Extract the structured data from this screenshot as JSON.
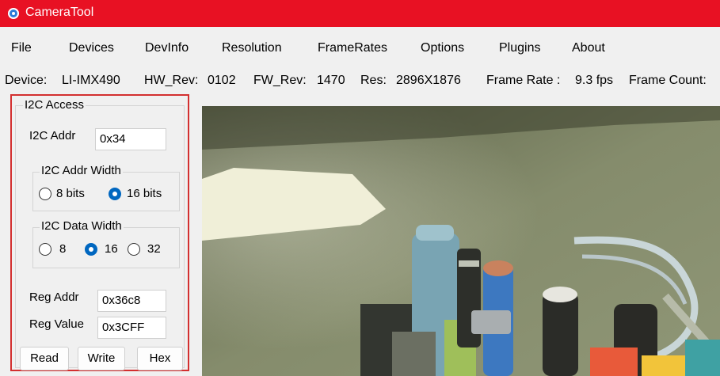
{
  "window": {
    "title": "CameraTool"
  },
  "menu": [
    "File",
    "Devices",
    "DevInfo",
    "Resolution",
    "FrameRates",
    "Options",
    "Plugins",
    "About"
  ],
  "info": {
    "device_label": "Device:",
    "device": "LI-IMX490",
    "hw_label": "HW_Rev:",
    "hw": "0102",
    "fw_label": "FW_Rev:",
    "fw": "1470",
    "res_label": "Res:",
    "res": "2896X1876",
    "fps_label": "Frame Rate :",
    "fps": "9.3 fps",
    "count_label": "Frame Count:"
  },
  "i2c": {
    "title": "I2C Access",
    "addr_label": "I2C Addr",
    "addr_value": "0x34",
    "addr_width": {
      "title": "I2C Addr Width",
      "options": [
        "8 bits",
        "16 bits"
      ],
      "selected": "16 bits"
    },
    "data_width": {
      "title": "I2C Data Width",
      "options": [
        "8",
        "16",
        "32"
      ],
      "selected": "16"
    },
    "reg_addr_label": "Reg Addr",
    "reg_addr_value": "0x36c8",
    "reg_value_label": "Reg Value",
    "reg_value_value": "0x3CFF",
    "buttons": {
      "read": "Read",
      "write": "Write",
      "hex": "Hex"
    }
  },
  "colors": {
    "titlebar": "#e81123",
    "highlight_border": "#d32f2f",
    "radio_selected": "#0067c0"
  }
}
